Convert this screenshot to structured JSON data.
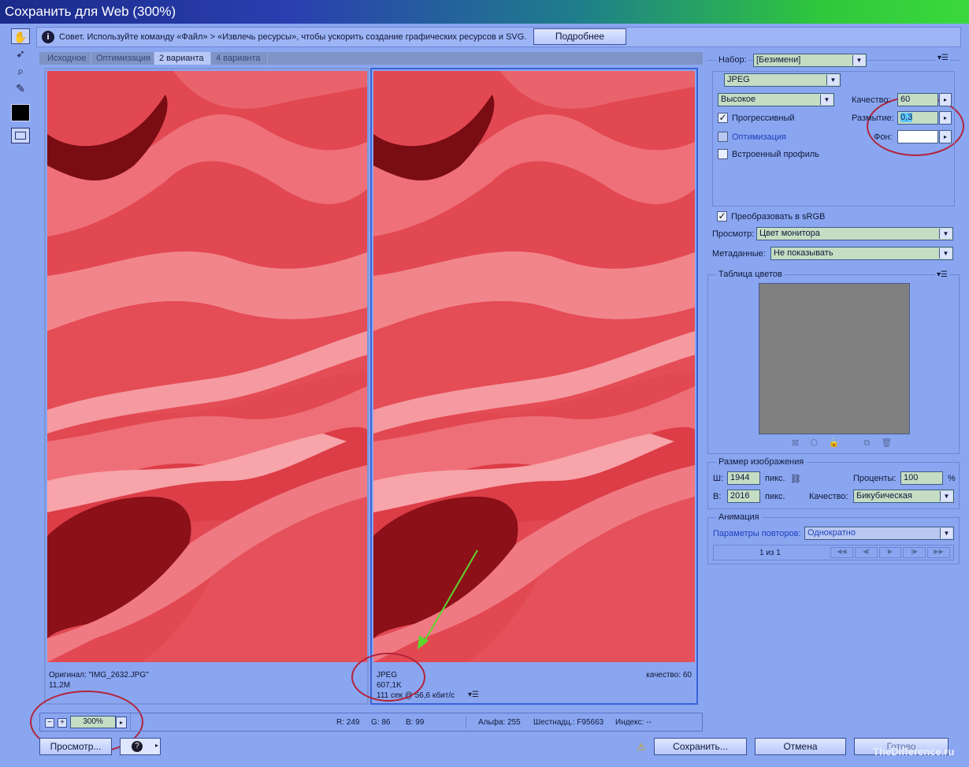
{
  "window": {
    "title": "Сохранить для Web (300%)"
  },
  "tip": {
    "text": "Совет. Используйте команду «Файл» > «Извлечь ресурсы», чтобы ускорить создание графических ресурсов и SVG.",
    "more_button": "Подробнее"
  },
  "tools": [
    "hand-tool",
    "slice-select-tool",
    "zoom-tool",
    "eyedropper-tool",
    "eyedropper-color",
    "toggle-slices"
  ],
  "tabs": [
    {
      "label": "Исходное",
      "active": false
    },
    {
      "label": "Оптимизация",
      "active": false
    },
    {
      "label": "2 варианта",
      "active": true
    },
    {
      "label": "4 варианта",
      "active": false
    }
  ],
  "left_pane": {
    "line1": "Оригинал: \"IMG_2632.JPG\"",
    "line2": "11,2M"
  },
  "right_pane": {
    "format": "JPEG",
    "size": "607,1K",
    "time": "111 сек @ 56,6 кбит/с",
    "quality": "качество: 60"
  },
  "status": {
    "zoom": "300%",
    "r": "R: 249",
    "g": "G: 86",
    "b": "B: 99",
    "alpha": "Альфа: 255",
    "hex": "Шестнадц.: F95663",
    "index": "Индекс: --"
  },
  "settings": {
    "preset_label": "Набор:",
    "preset_value": "[Безимени]",
    "format_value": "JPEG",
    "quality_preset": "Высокое",
    "quality_label": "Качество:",
    "quality_value": "60",
    "blur_label": "Размытие:",
    "blur_value": "0,3",
    "matte_label": "Фон:",
    "progressive": {
      "label": "Прогрессивный",
      "checked": true
    },
    "optimized": {
      "label": "Оптимизация",
      "checked": false
    },
    "embed_profile": {
      "label": "Встроенный профиль",
      "checked": false
    },
    "srgb": {
      "label": "Преобразовать в sRGB",
      "checked": true
    },
    "preview_label": "Просмотр:",
    "preview_value": "Цвет монитора",
    "metadata_label": "Метаданные:",
    "metadata_value": "Не показывать"
  },
  "color_table": {
    "title": "Таблица цветов"
  },
  "image_size": {
    "title": "Размер изображения",
    "w_label": "Ш:",
    "w_value": "1944",
    "h_label": "В:",
    "h_value": "2016",
    "unit": "пикс.",
    "percent_label": "Проценты:",
    "percent_value": "100",
    "percent_sign": "%",
    "quality_label": "Качество:",
    "quality_value": "Бикубическая"
  },
  "animation": {
    "title": "Анимация",
    "loop_label": "Параметры повторов:",
    "loop_value": "Однократно",
    "frame_counter": "1 из 1"
  },
  "bottom": {
    "preview_button": "Просмотр...",
    "save_button": "Сохранить...",
    "cancel_button": "Отмена",
    "done_button": "Готово"
  },
  "watermark": "TheDifference.ru",
  "colors": {
    "background": "#8aa6f0",
    "rose": "#e24852",
    "annotation_red": "#b3233a",
    "annotation_green": "#5dd62c"
  }
}
